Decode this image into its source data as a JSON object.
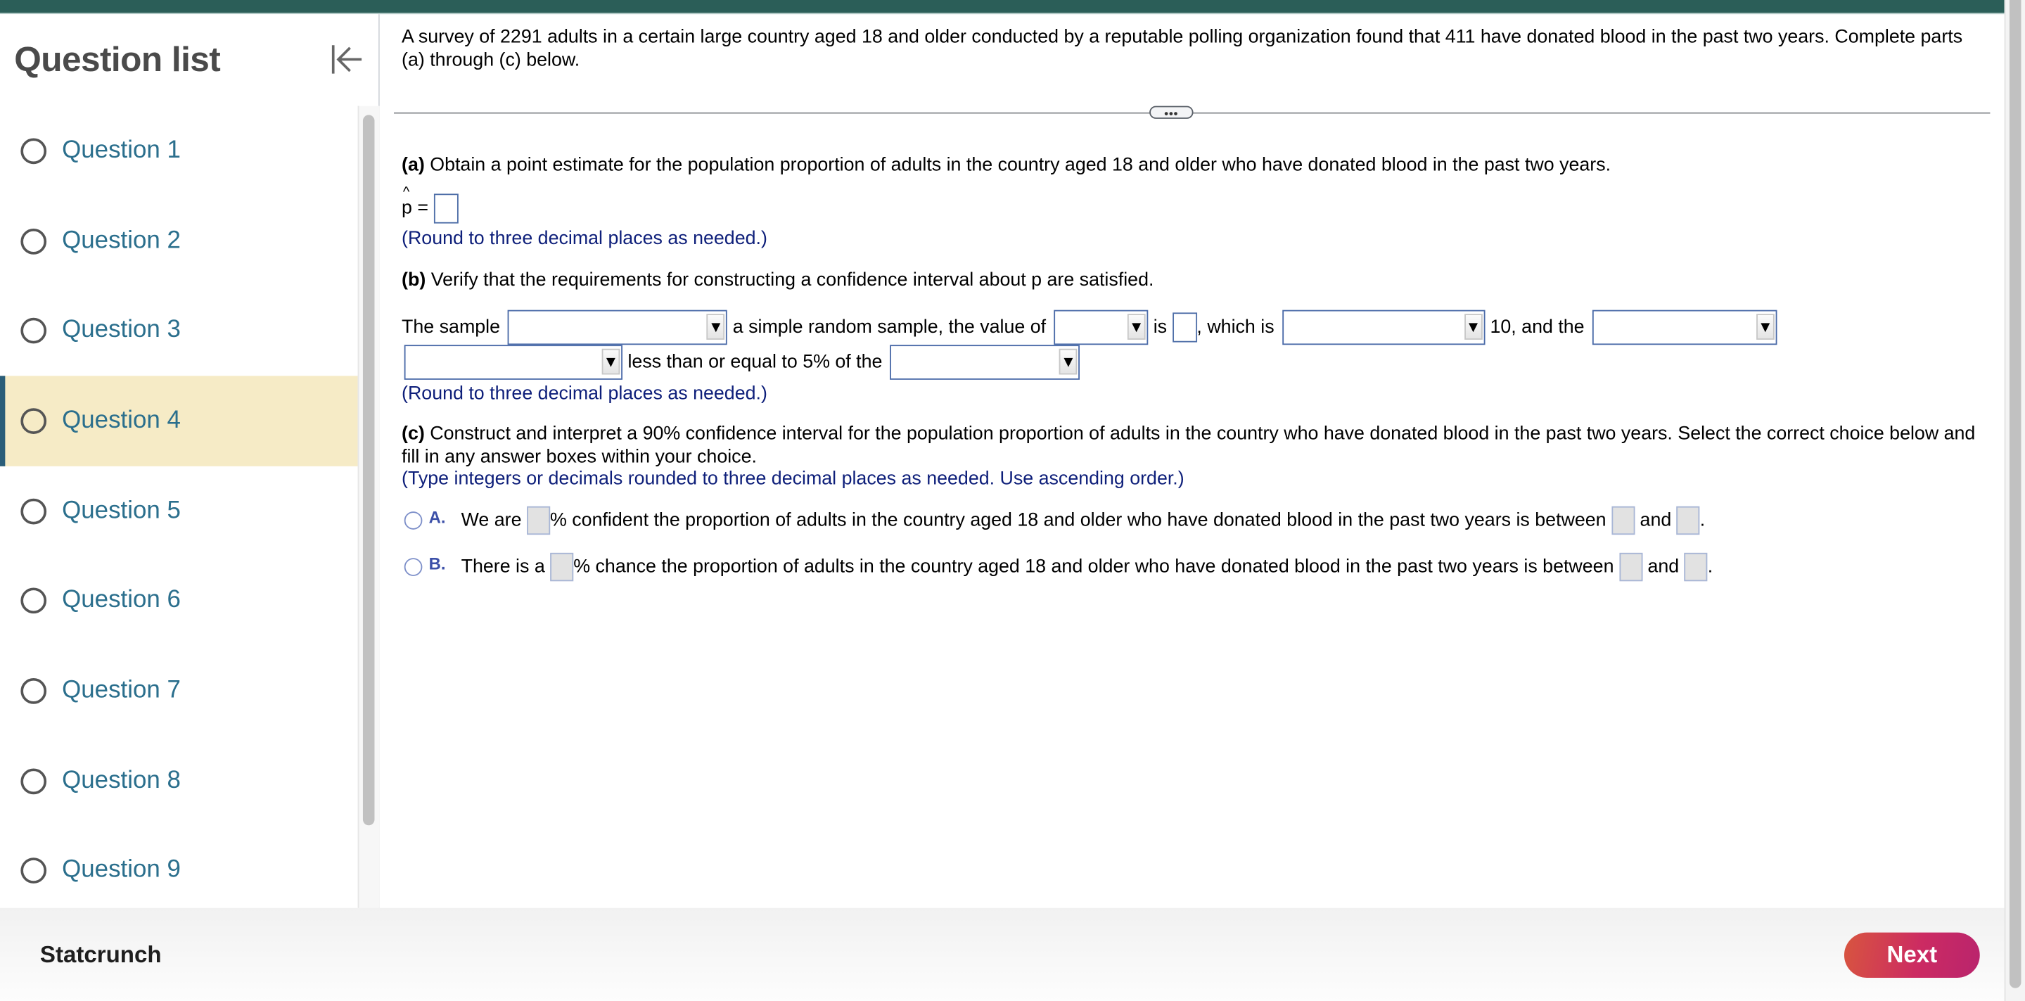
{
  "sidebar": {
    "title": "Question list",
    "collapse_icon": "collapse-left-icon",
    "active_index": 3,
    "items": [
      {
        "label": "Question 1"
      },
      {
        "label": "Question 2"
      },
      {
        "label": "Question 3"
      },
      {
        "label": "Question 4"
      },
      {
        "label": "Question 5"
      },
      {
        "label": "Question 6"
      },
      {
        "label": "Question 7"
      },
      {
        "label": "Question 8"
      },
      {
        "label": "Question 9"
      }
    ]
  },
  "question": {
    "intro": "A survey of 2291 adults in a certain large country aged 18 and older conducted by a reputable polling organization found that 411 have donated blood in the past two years. Complete parts (a) through (c) below.",
    "divider_handle": "•••",
    "part_a": {
      "label": "(a)",
      "text": " Obtain a point estimate for the population proportion of adults in the country aged 18 and older who have donated blood in the past two years.",
      "phat_symbol": "p",
      "phat_hat": "^",
      "equals": "=",
      "answer_value": "",
      "hint": "(Round to three decimal places as needed.)"
    },
    "part_b": {
      "label": "(b)",
      "text": " Verify that the requirements for constructing a confidence interval about p are satisfied.",
      "seg1": "The sample",
      "seg2": "a simple random sample, the value of",
      "seg3": "is",
      "seg4": ", which is",
      "seg5": "10, and the",
      "seg6": "less than or equal to 5% of the",
      "dropdowns": [
        "",
        "",
        "",
        "",
        "",
        ""
      ],
      "dropdown_arrow": "▼",
      "box_value": "",
      "hint": "(Round to three decimal places as needed.)"
    },
    "part_c": {
      "label": "(c)",
      "text": " Construct and interpret a 90% confidence interval for the population proportion of adults in the country who have donated blood in the past two years. Select the correct choice below and fill in any answer boxes within your choice.",
      "hint": "(Type integers or decimals rounded to three decimal places as needed. Use ascending order.)",
      "options": [
        {
          "letter": "A.",
          "pre": "We are",
          "mid": "% confident the proportion of adults in the country aged 18 and older who have donated blood in the past two years is between",
          "and": "and",
          "end": "."
        },
        {
          "letter": "B.",
          "pre": "There is a",
          "mid": "% chance the proportion of adults in the country aged 18 and older who have donated blood in the past two years is between",
          "and": "and",
          "end": "."
        }
      ]
    }
  },
  "footer": {
    "title": "Statcrunch",
    "next_label": "Next"
  },
  "colors": {
    "topbar": "#2b5e58",
    "active_item_bg": "#f6ebc6",
    "link": "#2b6f8d",
    "hint": "#0e1f7a",
    "next_button": "#cc2b62"
  }
}
